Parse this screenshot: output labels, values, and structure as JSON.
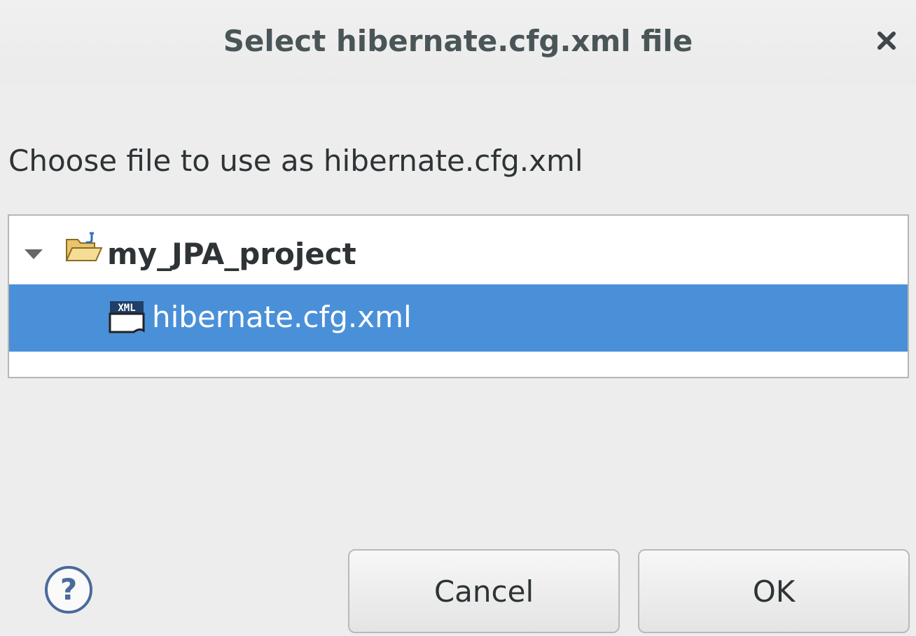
{
  "dialog": {
    "title": "Select hibernate.cfg.xml file",
    "close_icon": "close-icon"
  },
  "instruction": "Choose file to use as hibernate.cfg.xml",
  "tree": {
    "items": [
      {
        "label": "my_JPA_project",
        "icon": "project-folder-icon",
        "expanded": true,
        "selected": false
      },
      {
        "label": "hibernate.cfg.xml",
        "icon": "xml-file-icon",
        "selected": true
      }
    ]
  },
  "buttons": {
    "help_icon": "help-icon",
    "cancel_label": "Cancel",
    "ok_label": "OK"
  },
  "colors": {
    "selection": "#4a90d9",
    "background": "#ededed"
  }
}
